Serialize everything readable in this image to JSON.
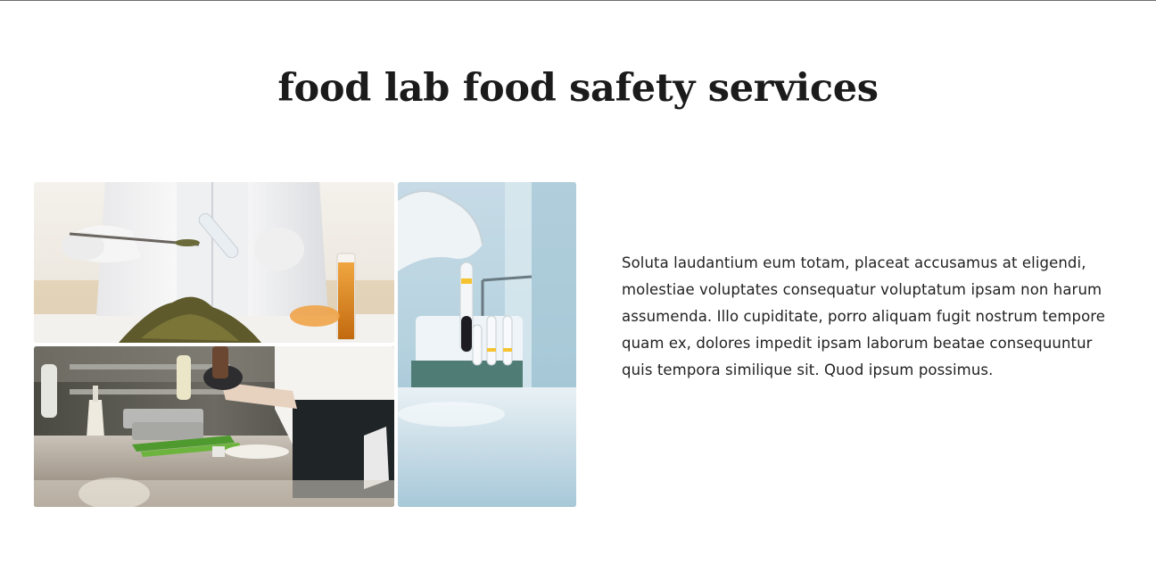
{
  "section": {
    "title": "food lab food safety services",
    "paragraph": "Soluta laudantium eum totam, placeat accusamus at eligendi, molestiae voluptates consequatur voluptatum ipsam non harum assumenda. Illo cupiditate, porro aliquam fugit nostrum tempore quam ex, dolores impedit ipsam laborum beatae consequuntur quis tempora similique sit. Quod ipsum possimus."
  },
  "colors": {
    "heading": "#1b1b1b",
    "text": "#222222",
    "rule": "#6e6e6e",
    "lab_blue": "#a9cbd9"
  }
}
